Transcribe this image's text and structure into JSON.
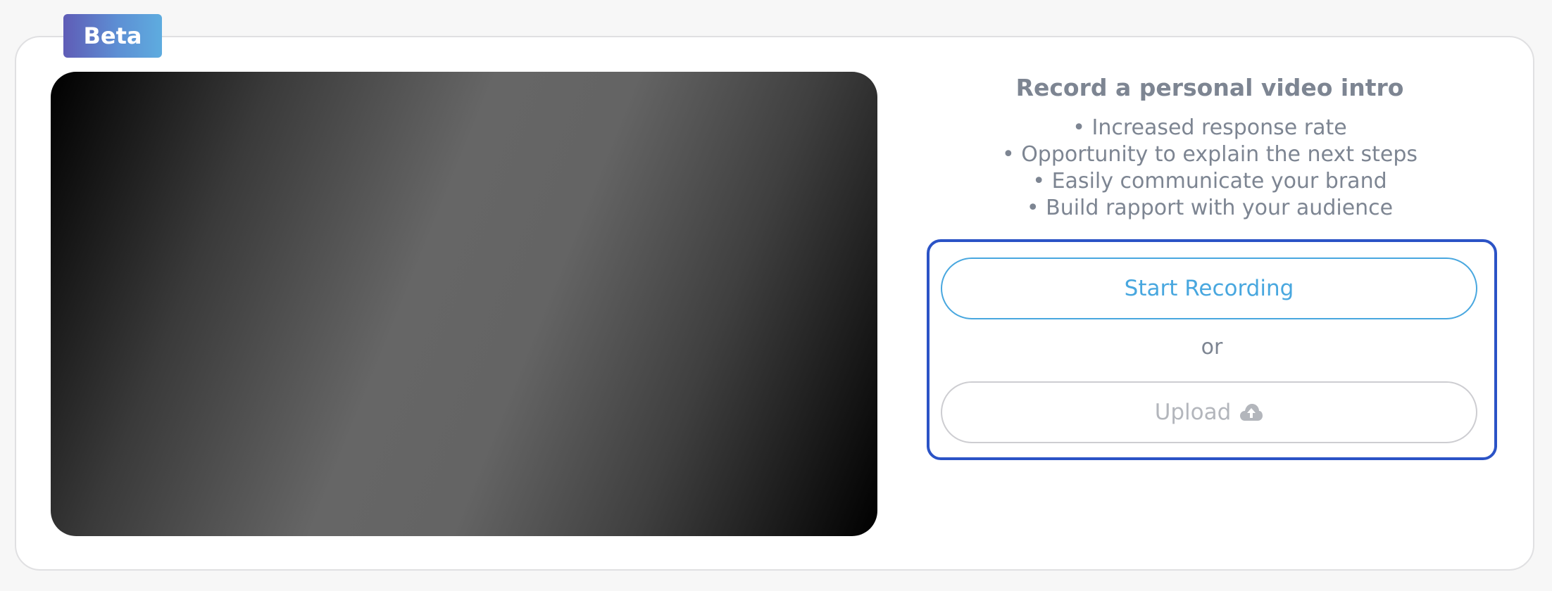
{
  "badge": {
    "label": "Beta"
  },
  "intro": {
    "title": "Record a personal video intro",
    "benefits": [
      "Increased response rate",
      "Opportunity to explain the next steps",
      "Easily communicate your brand",
      "Build rapport with your audience"
    ]
  },
  "actions": {
    "record_label": "Start Recording",
    "separator": "or",
    "upload_label": "Upload",
    "upload_icon": "cloud-upload-icon"
  },
  "colors": {
    "accent_blue": "#48a7df",
    "focus_border": "#2b53c6",
    "badge_start": "#5f5cb6",
    "badge_end": "#5eacdf",
    "muted_text": "#7d8592",
    "disabled_text": "#b3b6bc"
  }
}
